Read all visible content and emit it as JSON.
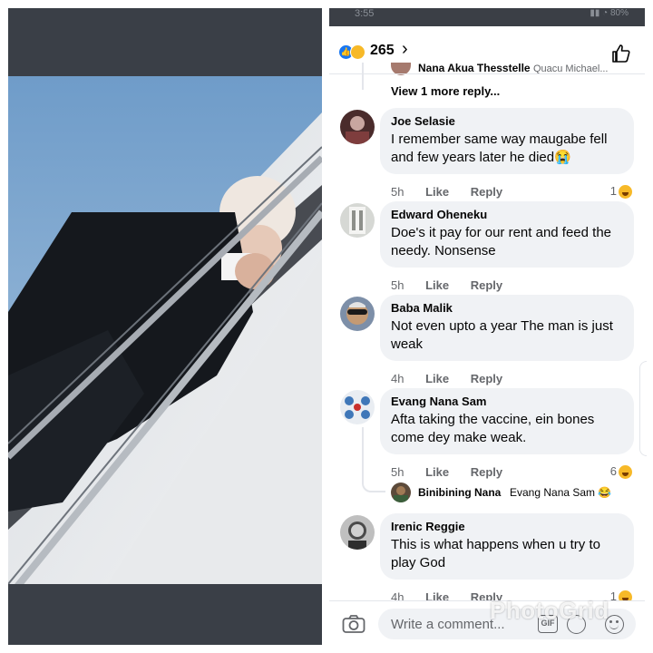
{
  "post": {
    "reaction_count": "265",
    "partial_reply": {
      "name": "Nana Akua Thesstelle",
      "tag": "Quacu Michael..."
    },
    "view_more": "View 1 more reply..."
  },
  "status": {
    "time": "3:55",
    "icons": "▮▮ ◔ 80%"
  },
  "comments": [
    {
      "name": "Joe Selasie",
      "text": "I remember same way maugabe fell and few years later he died😭",
      "time": "5h",
      "like": "Like",
      "reply": "Reply",
      "reactions": "1"
    },
    {
      "name": "Edward Oheneku",
      "text": "Doe's it pay for our rent and feed the needy. Nonsense",
      "time": "5h",
      "like": "Like",
      "reply": "Reply",
      "reactions": ""
    },
    {
      "name": "Baba Malik",
      "text": "Not even upto a year The man is just weak",
      "time": "4h",
      "like": "Like",
      "reply": "Reply",
      "reactions": ""
    },
    {
      "name": "Evang Nana Sam",
      "text": "Afta taking the vaccine, ein bones come dey make weak.",
      "time": "5h",
      "like": "Like",
      "reply": "Reply",
      "reactions": "6"
    },
    {
      "name": "Irenic Reggie",
      "text": "This is what happens when u try to play God",
      "time": "4h",
      "like": "Like",
      "reply": "Reply",
      "reactions": "1"
    }
  ],
  "reply_preview": {
    "name": "Binibining Nana",
    "tag": "Evang Nana Sam 😂"
  },
  "composer": {
    "placeholder": "Write a comment...",
    "gif": "GIF"
  },
  "watermark": "PhotoGrid",
  "colors": {
    "accent": "#1877f2",
    "bubble": "#f0f2f5",
    "haha": "#f7b928",
    "meta_text": "#65676b"
  },
  "icons": [
    "like-icon",
    "haha-icon",
    "chevron-right-icon",
    "thumbs-up-icon",
    "camera-icon",
    "gif-icon",
    "sticker-icon",
    "emoji-icon"
  ]
}
